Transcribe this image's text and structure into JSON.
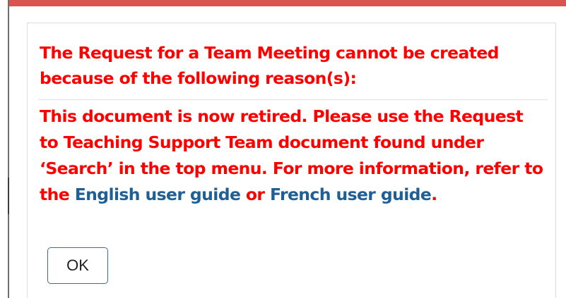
{
  "dialog": {
    "heading": "The Request for a Team Meeting cannot be created because of the following reason(s):",
    "message": {
      "text_before_links": "This document is now retired. Please use the Request to Teaching Support Team document found under ‘Search’ in the top menu. For more information, refer to the ",
      "english_guide_link": "English user guide",
      "connector": " or ",
      "french_guide_link": "French user guide",
      "end_punctuation": "."
    },
    "ok_label": "OK"
  },
  "colors": {
    "error_text": "#ff0000",
    "link_text": "#1f5f93",
    "top_bar": "#d9534f",
    "button_border": "#3b6a93"
  }
}
